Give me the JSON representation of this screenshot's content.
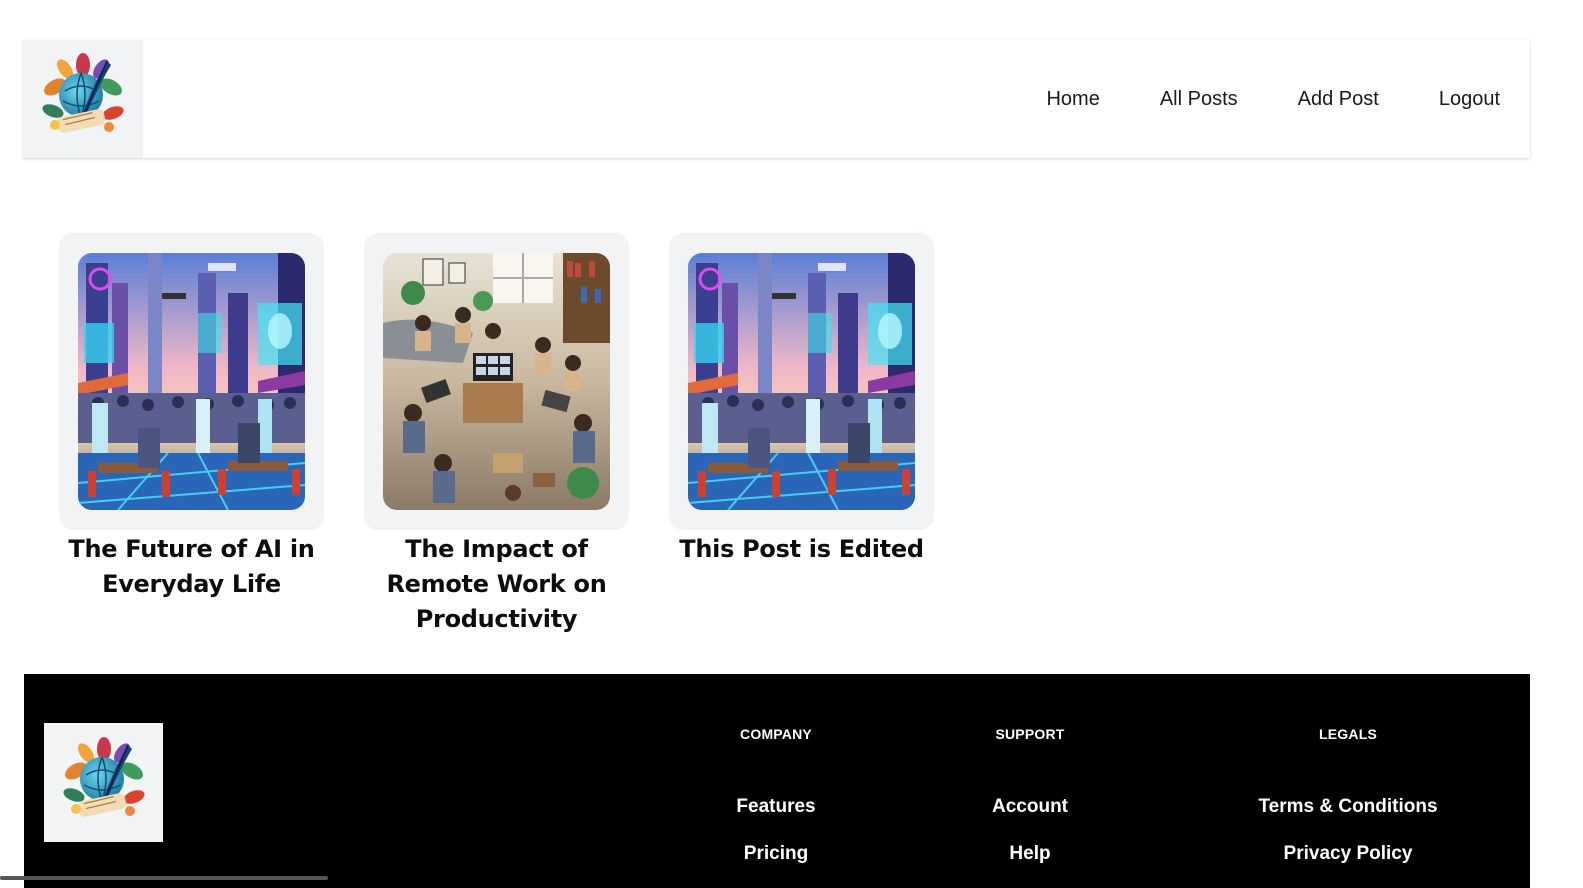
{
  "nav": {
    "items": [
      {
        "label": "Home"
      },
      {
        "label": "All Posts"
      },
      {
        "label": "Add Post"
      },
      {
        "label": "Logout"
      }
    ]
  },
  "posts": [
    {
      "title": "The Future of AI in Everyday Life",
      "image": "futuristic-ai-city-cafe"
    },
    {
      "title": "The Impact of Remote Work on Productivity",
      "image": "remote-work-living-room"
    },
    {
      "title": "This Post is Edited",
      "image": "futuristic-ai-city-cafe"
    }
  ],
  "footer": {
    "columns": [
      {
        "heading": "COMPANY",
        "links": [
          "Features",
          "Pricing"
        ]
      },
      {
        "heading": "SUPPORT",
        "links": [
          "Account",
          "Help"
        ]
      },
      {
        "heading": "LEGALS",
        "links": [
          "Terms & Conditions",
          "Privacy Policy"
        ]
      }
    ]
  },
  "colors": {
    "header_bg": "#ffffff",
    "logo_bg": "#f1f3f4",
    "card_bg": "#f1f3f4",
    "footer_bg": "#000000",
    "footer_text": "#ffffff"
  }
}
